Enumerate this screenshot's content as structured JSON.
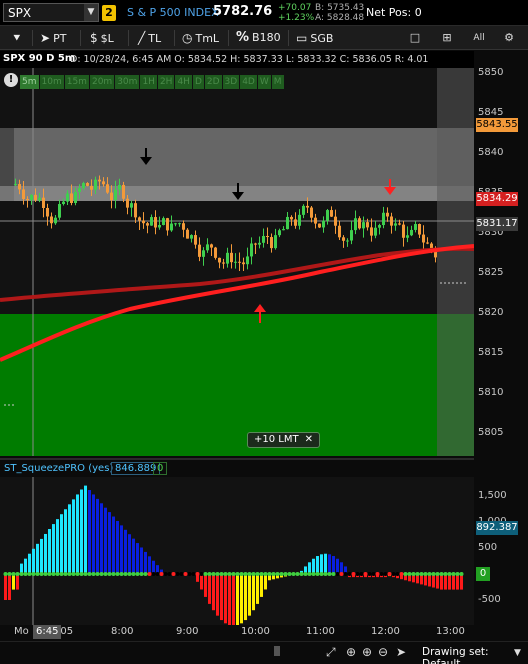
{
  "symbol_bar": {
    "symbol": "SPX",
    "dropdown": "▼",
    "link_group": "2",
    "description": "S & P 500 INDEX",
    "last": "5782.76",
    "change": "+70.07",
    "change_pct": "+1.23%",
    "bid": "B: 5735.43",
    "ask": "A: 5828.48",
    "net_pos": "Net Pos: 0"
  },
  "toolbar": {
    "pin_label": "",
    "pointer_label": "PT",
    "dollar_label": "$L",
    "trendline_label": "TL",
    "timeline_label": "TmL",
    "percent_label": "B180",
    "box_label": "SGB",
    "all_label": "All"
  },
  "chart_info": {
    "symbol_tf": "SPX 90 D 5m",
    "stats": "D: 10/28/24, 6:45 AM   O: 5834.52   H: 5837.33   L: 5833.32   C: 5836.05   R: 4.01"
  },
  "timeframes": [
    "5m",
    "10m",
    "15m",
    "20m",
    "30m",
    "1H",
    "2H",
    "4H",
    "D",
    "2D",
    "3D",
    "4D",
    "W",
    "M"
  ],
  "alert_icon": "!",
  "order_chip": {
    "label": "+10 LMT",
    "close": "✕"
  },
  "price_axis": {
    "ticks": [
      "5850",
      "5845",
      "5840",
      "5835",
      "5830",
      "5825",
      "5820",
      "5815",
      "5810",
      "5805"
    ],
    "tags": [
      {
        "value": "5843.55",
        "color": "#f39a3a",
        "text_color": "#000000"
      },
      {
        "value": "5834.29",
        "color": "#d42020",
        "text_color": "#ffffff"
      },
      {
        "value": "5831.17",
        "color": "#3a3a3a",
        "text_color": "#ffffff"
      }
    ]
  },
  "indicator": {
    "name": "ST_SqueezePRO (yes)",
    "value": "846.889",
    "value2": "0",
    "axis": [
      "1,500",
      "1,000",
      "500",
      "0",
      "-500"
    ],
    "current_tag": "892.387",
    "zero_tag": "0"
  },
  "time_axis": {
    "labels": [
      "Mo",
      "8:00",
      "9:00",
      "10:00",
      "11:00",
      "12:00",
      "13:00"
    ],
    "cursor": "6:45",
    "cursor_suffix": ":05"
  },
  "bottom_bar": {
    "drawing_set": "Drawing set: Default"
  },
  "colors": {
    "up_candle": "#3fcf4f",
    "down_candle": "#f39a3a",
    "supply_zone": "#7a7a7a",
    "demand_zone": "#007c00",
    "ma_fast": "#ff1f1f",
    "ma_slow": "#c01818",
    "hist_cyan": "#1ee6ff",
    "hist_blue": "#0a1fe0",
    "hist_red": "#ff1a1a",
    "hist_yellow": "#ffee00"
  }
}
